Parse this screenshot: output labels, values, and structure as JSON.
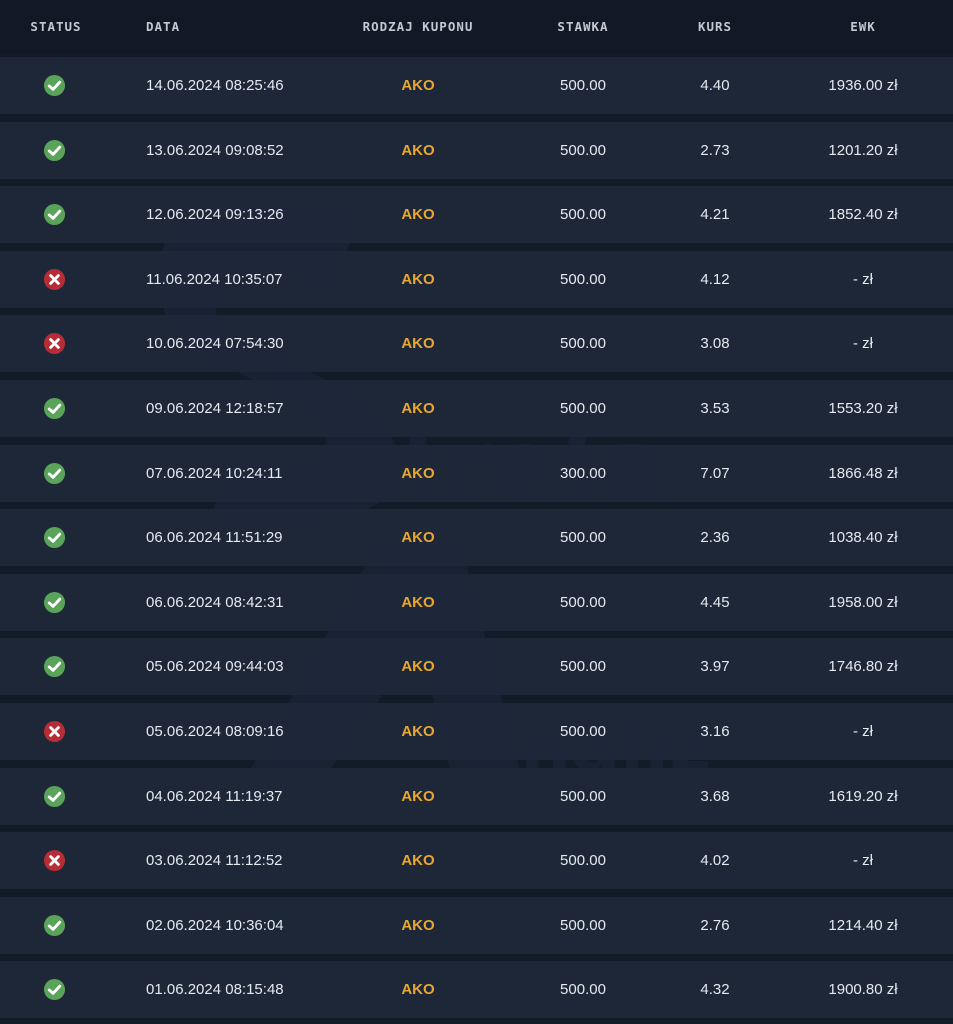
{
  "headers": {
    "status": "STATUS",
    "date": "DATA",
    "coupon_type": "RODZAJ KUPONU",
    "stake": "STAWKA",
    "odds": "KURS",
    "payout": "EWK"
  },
  "colors": {
    "won": "#5aa35a",
    "lost": "#b52d36",
    "coupon_type": "#e8a72f"
  },
  "rows": [
    {
      "status": "won",
      "date": "14.06.2024 08:25:46",
      "type": "AKO",
      "stake": "500.00",
      "odds": "4.40",
      "payout": "1936.00 zł"
    },
    {
      "status": "won",
      "date": "13.06.2024 09:08:52",
      "type": "AKO",
      "stake": "500.00",
      "odds": "2.73",
      "payout": "1201.20 zł"
    },
    {
      "status": "won",
      "date": "12.06.2024 09:13:26",
      "type": "AKO",
      "stake": "500.00",
      "odds": "4.21",
      "payout": "1852.40 zł"
    },
    {
      "status": "lost",
      "date": "11.06.2024 10:35:07",
      "type": "AKO",
      "stake": "500.00",
      "odds": "4.12",
      "payout": "- zł"
    },
    {
      "status": "lost",
      "date": "10.06.2024 07:54:30",
      "type": "AKO",
      "stake": "500.00",
      "odds": "3.08",
      "payout": "- zł"
    },
    {
      "status": "won",
      "date": "09.06.2024 12:18:57",
      "type": "AKO",
      "stake": "500.00",
      "odds": "3.53",
      "payout": "1553.20 zł"
    },
    {
      "status": "won",
      "date": "07.06.2024 10:24:11",
      "type": "AKO",
      "stake": "300.00",
      "odds": "7.07",
      "payout": "1866.48 zł"
    },
    {
      "status": "won",
      "date": "06.06.2024 11:51:29",
      "type": "AKO",
      "stake": "500.00",
      "odds": "2.36",
      "payout": "1038.40 zł"
    },
    {
      "status": "won",
      "date": "06.06.2024 08:42:31",
      "type": "AKO",
      "stake": "500.00",
      "odds": "4.45",
      "payout": "1958.00 zł"
    },
    {
      "status": "won",
      "date": "05.06.2024 09:44:03",
      "type": "AKO",
      "stake": "500.00",
      "odds": "3.97",
      "payout": "1746.80 zł"
    },
    {
      "status": "lost",
      "date": "05.06.2024 08:09:16",
      "type": "AKO",
      "stake": "500.00",
      "odds": "3.16",
      "payout": "- zł"
    },
    {
      "status": "won",
      "date": "04.06.2024 11:19:37",
      "type": "AKO",
      "stake": "500.00",
      "odds": "3.68",
      "payout": "1619.20 zł"
    },
    {
      "status": "lost",
      "date": "03.06.2024 11:12:52",
      "type": "AKO",
      "stake": "500.00",
      "odds": "4.02",
      "payout": "- zł"
    },
    {
      "status": "won",
      "date": "02.06.2024 10:36:04",
      "type": "AKO",
      "stake": "500.00",
      "odds": "2.76",
      "payout": "1214.40 zł"
    },
    {
      "status": "won",
      "date": "01.06.2024 08:15:48",
      "type": "AKO",
      "stake": "500.00",
      "odds": "4.32",
      "payout": "1900.80 zł"
    }
  ]
}
